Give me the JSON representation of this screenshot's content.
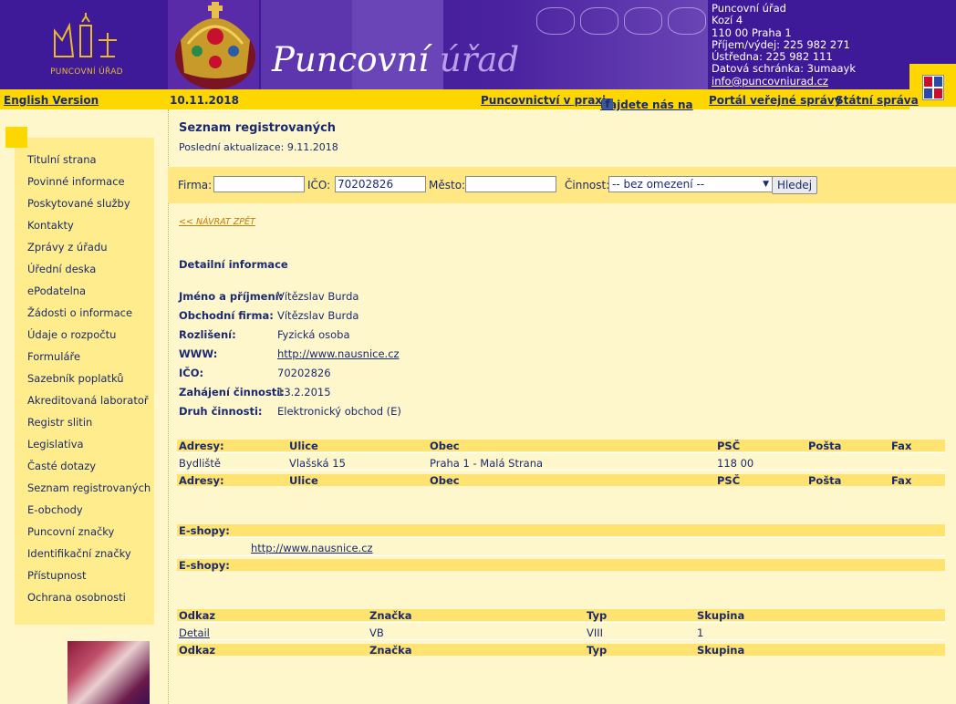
{
  "header": {
    "logo_text": "PUNCOVNÍ ÚŘAD",
    "title_part1": "Puncovní",
    "title_part2": "úřad",
    "address": {
      "name": "Puncovní úřad",
      "street": "Kozí 4",
      "city": "110 00 Praha 1",
      "phone1": "Příjem/výdej: 225 982 271",
      "phone2": "Ústředna: 225 982 111",
      "databox": "Datová schránka: 3umaayk",
      "email": "info@puncovniurad.cz"
    }
  },
  "topbar": {
    "english": "English Version",
    "date": "10.11.2018",
    "links": [
      "Puncovnictví v praxi",
      "Najdete nás na",
      "Portál veřejné správy",
      "Státní správa"
    ],
    "facebook_icon": "f"
  },
  "sidebar": {
    "items": [
      "Titulní strana",
      "Povinné informace",
      "Poskytované služby",
      "Kontakty",
      "Zprávy z úřadu",
      "Úřední deska",
      "ePodatelna",
      "Žádosti o informace",
      "Údaje o rozpočtu",
      "Formuláře",
      "Sazebník poplatků",
      "Akreditovaná laboratoř",
      "Registr slitin",
      "Legislativa",
      "Časté dotazy",
      "Seznam registrovaných",
      "E-obchody",
      "Puncovní značky",
      "Identifikační značky",
      "Přístupnost",
      "Ochrana osobnosti"
    ]
  },
  "content": {
    "title": "Seznam registrovaných",
    "last_update": "Poslední aktualizace: 9.11.2018",
    "search": {
      "firma_label": "Firma:",
      "firma_value": "",
      "ico_label": "IČO:",
      "ico_value": "70202826",
      "mesto_label": "Město:",
      "mesto_value": "",
      "cinnost_label": "Činnost:",
      "cinnost_value": "-- bez omezení --",
      "button": "Hledej"
    },
    "back_link": "<< NÁVRAT ZPĚT",
    "detail_heading": "Detailní informace",
    "details": [
      {
        "label": "Jméno a příjmení:",
        "value": "Vítězslav Burda"
      },
      {
        "label": "Obchodní firma:",
        "value": "Vítězslav Burda"
      },
      {
        "label": "Rozlišení:",
        "value": "Fyzická osoba"
      },
      {
        "label": "WWW:",
        "value": "http://www.nausnice.cz"
      },
      {
        "label": "IČO:",
        "value": "70202826"
      },
      {
        "label": "Zahájení činnosti:",
        "value": "13.2.2015"
      },
      {
        "label": "Druh činnosti:",
        "value": "Elektronický obchod (E)"
      }
    ],
    "addresses": {
      "headers": [
        "Adresy:",
        "Ulice",
        "Obec",
        "PSČ",
        "Pošta",
        "Fax"
      ],
      "row": [
        "Bydliště",
        "Vlašská 15",
        "Praha 1 - Malá Strana",
        "118 00",
        "",
        ""
      ]
    },
    "eshops": {
      "header": "E-shopy:",
      "url": "http://www.nausnice.cz"
    },
    "marks": {
      "headers": [
        "Odkaz",
        "Značka",
        "Typ",
        "Skupina"
      ],
      "row": [
        "Detail",
        "VB",
        "VIII",
        "1"
      ]
    }
  },
  "colors": {
    "header_bg": "#3f1a98",
    "accent_yellow": "#ffd700",
    "page_bg": "#fff7cc",
    "sidebar_bg": "#ffec8c",
    "text": "#1a2a70"
  }
}
